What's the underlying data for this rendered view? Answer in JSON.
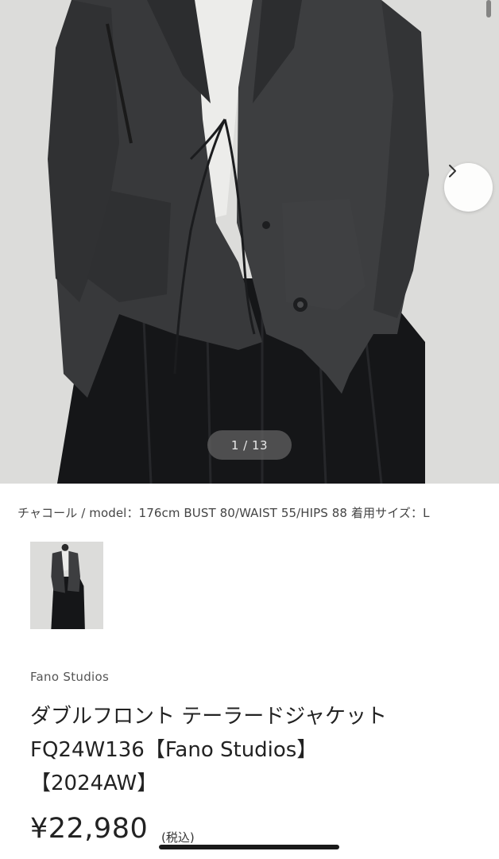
{
  "gallery": {
    "counter": "1 / 13",
    "next_icon": "chevron-right-icon",
    "image_alt": "charcoal tailored jacket"
  },
  "caption": "チャコール / model：176cm BUST 80/WAIST 55/HIPS 88 着用サイズ：L",
  "product": {
    "brand": "Fano Studios",
    "title_lines": [
      "ダブルフロント テーラードジャケット",
      "FQ24W136【Fano Studios】",
      "【2024AW】"
    ],
    "price": "¥22,980",
    "tax_note": "(税込)"
  },
  "colors": {
    "background": "#ffffff",
    "photo_backdrop": "#d9d9d7",
    "jacket": "#3a3b3d",
    "skirt": "#161719",
    "counter_bg": "#5f5f5f"
  }
}
